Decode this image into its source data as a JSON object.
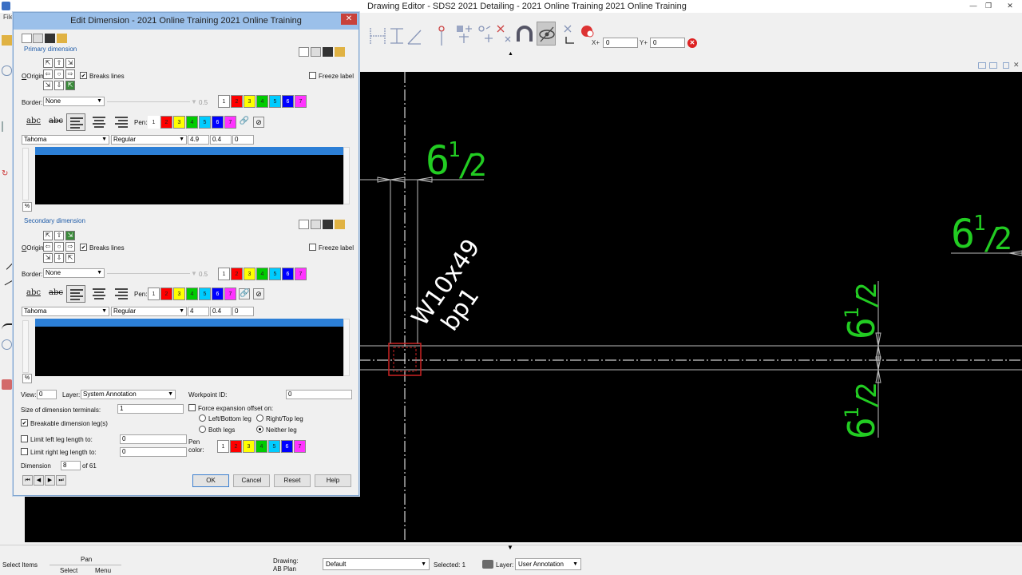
{
  "main": {
    "title": "Drawing Editor - SDS2 2021 Detailing - 2021 Online Training 2021 Online Training",
    "file_menu": "File",
    "window_controls": [
      "minimize-icon",
      "restore-icon",
      "close-icon"
    ],
    "coords": {
      "x_label": "X+",
      "x_value": "0",
      "y_label": "Y+",
      "y_value": "0"
    }
  },
  "dialog": {
    "title": "Edit Dimension - 2021 Online Training 2021 Online Training",
    "primary": {
      "label": "Primary dimension",
      "origin_label": "Origin:",
      "breaks_lines_label": "Breaks lines",
      "breaks_lines_checked": true,
      "freeze_label": "Freeze label",
      "freeze_checked": false,
      "border_label": "Border:",
      "border_value": "None",
      "border_width": "0.5",
      "pen_label": "Pen:",
      "font_name": "Tahoma",
      "font_style": "Regular",
      "font_size": "4.9",
      "font_width": "0.4",
      "font_angle": "0",
      "percent_label": "%"
    },
    "secondary": {
      "label": "Secondary dimension",
      "origin_label": "Origin:",
      "breaks_lines_label": "Breaks lines",
      "breaks_lines_checked": true,
      "freeze_label": "Freeze label",
      "freeze_checked": false,
      "border_label": "Border:",
      "border_value": "None",
      "border_width": "0.5",
      "pen_label": "Pen:",
      "font_name": "Tahoma",
      "font_style": "Regular",
      "font_size": "4",
      "font_width": "0.4",
      "font_angle": "0",
      "percent_label": "%"
    },
    "pens": [
      {
        "n": "1",
        "color": "#ffffff"
      },
      {
        "n": "2",
        "color": "#ff0000"
      },
      {
        "n": "3",
        "color": "#ffff00"
      },
      {
        "n": "4",
        "color": "#00cc00"
      },
      {
        "n": "5",
        "color": "#00ccff"
      },
      {
        "n": "6",
        "color": "#0000ff"
      },
      {
        "n": "7",
        "color": "#ff33ff"
      }
    ],
    "abc_underline": "abc",
    "abc_strike": "abc",
    "view_label": "View:",
    "view_value": "0",
    "layer_label": "Layer:",
    "layer_value": "System Annotation",
    "workpoint_label": "Workpoint ID:",
    "workpoint_value": "0",
    "terminal_size_label": "Size of dimension terminals:",
    "terminal_size_value": "1",
    "breakable_label": "Breakable dimension leg(s)",
    "breakable_checked": true,
    "force_expansion_label": "Force expansion offset on:",
    "force_expansion_checked": false,
    "radio_left_bottom": "Left/Bottom leg",
    "radio_right_top": "Right/Top leg",
    "radio_both": "Both legs",
    "radio_neither": "Neither leg",
    "limit_left_label": "Limit left leg length to:",
    "limit_left_value": "0",
    "limit_right_label": "Limit right leg length to:",
    "limit_right_value": "0",
    "pen_color_label_1": "Pen",
    "pen_color_label_2": "color:",
    "dimension_label": "Dimension",
    "dimension_value": "8",
    "dimension_of": "of 61",
    "buttons": {
      "ok": "OK",
      "cancel": "Cancel",
      "reset": "Reset",
      "help": "Help"
    }
  },
  "canvas": {
    "dim_text_primary": "6",
    "dim_text_super": "1",
    "dim_text_slash": "/",
    "dim_text_denom": "2",
    "member_label": "W10x49",
    "member_sublabel": "bp1",
    "colors": {
      "dimension": "#22cc22",
      "background": "#000000",
      "lines": "#ffffff",
      "member": "#cc2222"
    }
  },
  "status": {
    "select_items": "Select Items",
    "pan": "Pan",
    "select": "Select",
    "menu": "Menu",
    "drawing_label": "Drawing:",
    "drawing_name": "AB Plan",
    "view_value": "Default",
    "selected": "Selected: 1",
    "layer_label": "Layer:",
    "layer_value": "User Annotation"
  }
}
